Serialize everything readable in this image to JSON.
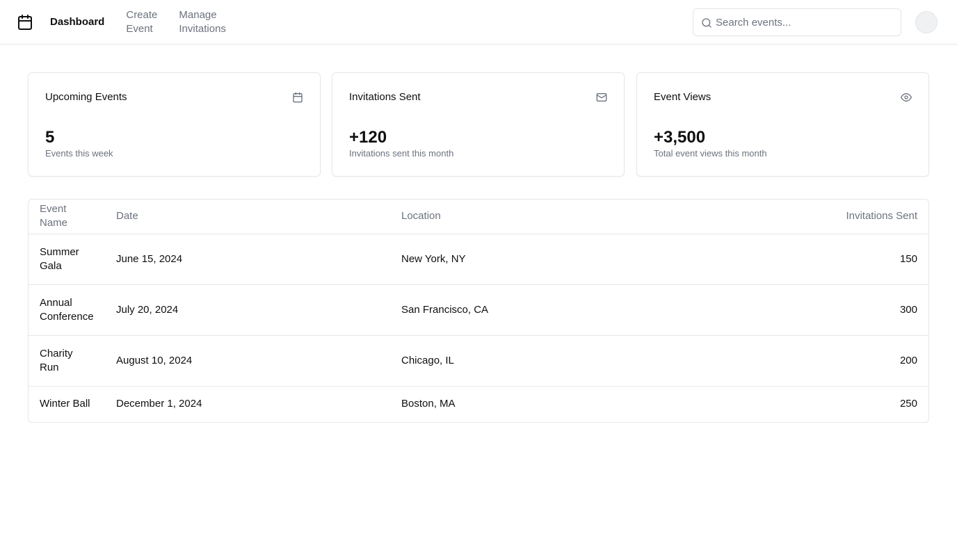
{
  "header": {
    "logo_icon": "calendar-icon",
    "nav": [
      {
        "label": "Dashboard",
        "active": true
      },
      {
        "label": "Create Event",
        "line1": "Create",
        "line2": "Event",
        "active": false
      },
      {
        "label": "Manage Invitations",
        "line1": "Manage",
        "line2": "Invitations",
        "active": false
      }
    ],
    "search": {
      "placeholder": "Search events...",
      "value": "",
      "icon": "search-icon"
    },
    "avatar": {
      "icon": "avatar"
    }
  },
  "stats": [
    {
      "title": "Upcoming Events",
      "value": "5",
      "subtitle": "Events this week",
      "icon": "calendar-icon"
    },
    {
      "title": "Invitations Sent",
      "value": "+120",
      "subtitle": "Invitations sent this month",
      "icon": "mail-icon"
    },
    {
      "title": "Event Views",
      "value": "+3,500",
      "subtitle": "Total event views this month",
      "icon": "eye-icon"
    }
  ],
  "table": {
    "columns": {
      "name_line1": "Event",
      "name_line2": "Name",
      "date": "Date",
      "location": "Location",
      "invitations": "Invitations Sent"
    },
    "rows": [
      {
        "name": "Summer Gala",
        "date": "June 15, 2024",
        "location": "New York, NY",
        "invitations": "150"
      },
      {
        "name": "Annual Conference",
        "date": "July 20, 2024",
        "location": "San Francisco, CA",
        "invitations": "300"
      },
      {
        "name": "Charity Run",
        "date": "August 10, 2024",
        "location": "Chicago, IL",
        "invitations": "200"
      },
      {
        "name": "Winter Ball",
        "date": "December 1, 2024",
        "location": "Boston, MA",
        "invitations": "250"
      }
    ]
  },
  "colors": {
    "text": "#0f0f10",
    "muted": "#6b7280",
    "border": "#e5e7eb"
  }
}
